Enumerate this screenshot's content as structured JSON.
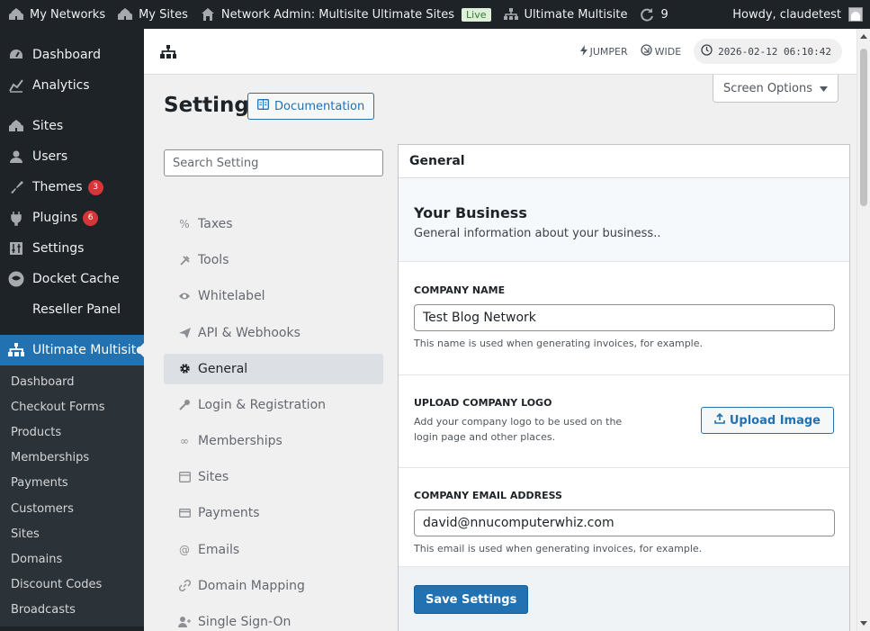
{
  "adminbar": {
    "my_networks": "My Networks",
    "my_sites": "My Sites",
    "network_admin": "Network Admin: Multisite Ultimate Sites",
    "live_badge": "Live",
    "ultimate_multisite": "Ultimate Multisite",
    "updates_count": "9",
    "howdy": "Howdy, claudetest"
  },
  "sidebar": {
    "items": [
      {
        "label": "Dashboard",
        "icon": "dashboard-icon"
      },
      {
        "label": "Analytics",
        "icon": "analytics-icon"
      },
      {
        "label": "Sites",
        "icon": "sites-icon"
      },
      {
        "label": "Users",
        "icon": "users-icon"
      },
      {
        "label": "Themes",
        "icon": "themes-icon",
        "badge": "3"
      },
      {
        "label": "Plugins",
        "icon": "plugins-icon",
        "badge": "6"
      },
      {
        "label": "Settings",
        "icon": "settings-icon"
      },
      {
        "label": "Docket Cache",
        "icon": "docket-cache-icon"
      },
      {
        "label": "Reseller Panel",
        "icon": ""
      }
    ],
    "active": {
      "label": "Ultimate Multisite",
      "icon": "network-icon"
    },
    "submenu": [
      "Dashboard",
      "Checkout Forms",
      "Products",
      "Memberships",
      "Payments",
      "Customers",
      "Sites",
      "Domains",
      "Discount Codes",
      "Broadcasts"
    ]
  },
  "topstrip": {
    "jumper": "JUMPER",
    "wide": "WIDE",
    "clock": "2026-02-12 06:10:42"
  },
  "screen_options": "Screen Options",
  "page": {
    "title": "Settings",
    "documentation": "Documentation"
  },
  "settings_nav": {
    "search_placeholder": "Search Setting",
    "items": [
      {
        "label": "Taxes",
        "icon": "percent-icon"
      },
      {
        "label": "Tools",
        "icon": "tools-icon"
      },
      {
        "label": "Whitelabel",
        "icon": "eye-icon"
      },
      {
        "label": "API & Webhooks",
        "icon": "send-icon"
      },
      {
        "label": "General",
        "icon": "gear-icon",
        "active": true
      },
      {
        "label": "Login & Registration",
        "icon": "key-icon"
      },
      {
        "label": "Memberships",
        "icon": "infinity-icon"
      },
      {
        "label": "Sites",
        "icon": "browser-icon"
      },
      {
        "label": "Payments",
        "icon": "credit-card-icon"
      },
      {
        "label": "Emails",
        "icon": "at-icon"
      },
      {
        "label": "Domain Mapping",
        "icon": "link-icon"
      },
      {
        "label": "Single Sign-On",
        "icon": "user-login-icon"
      }
    ]
  },
  "panel": {
    "heading": "General",
    "business_title": "Your Business",
    "business_desc": "General information about your business..",
    "company_name": {
      "label": "Company Name",
      "value": "Test Blog Network",
      "help": "This name is used when generating invoices, for example."
    },
    "company_logo": {
      "label": "Upload Company Logo",
      "help": "Add your company logo to be used on the login page and other places.",
      "button": "Upload Image"
    },
    "company_email": {
      "label": "Company Email Address",
      "value": "david@nnucomputerwhiz.com",
      "help": "This email is used when generating invoices, for example."
    },
    "save_button": "Save Settings"
  }
}
